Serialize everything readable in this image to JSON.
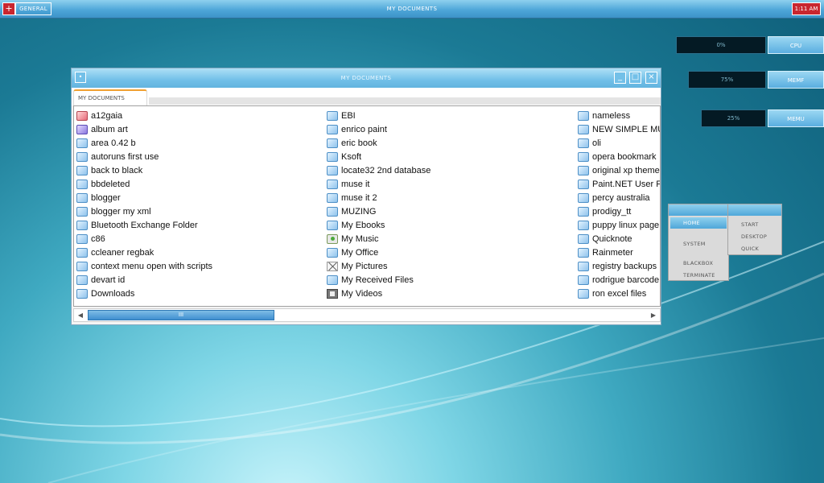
{
  "topbar": {
    "menu_button": "+",
    "general_label": "GENERAL",
    "title": "MY DOCUMENTS",
    "clock": "1:11 AM"
  },
  "meters": [
    {
      "value": "0%",
      "label": "CPU"
    },
    {
      "value": "75%",
      "label": "MEMF"
    },
    {
      "value": "25%",
      "label": "MEMU"
    }
  ],
  "window": {
    "title": "MY DOCUMENTS",
    "tab_label": "MY DOCUMENTS",
    "minimize": "_",
    "maximize": "□",
    "close": "×",
    "system_menu": "•",
    "scroll_thumb": "III",
    "scroll_left": "◀",
    "scroll_right": "▶",
    "columns": [
      [
        {
          "name": "a12gaia",
          "icon": "folder-red"
        },
        {
          "name": "album art",
          "icon": "folder-purple"
        },
        {
          "name": "area 0.42 b",
          "icon": "folder"
        },
        {
          "name": "autoruns first use",
          "icon": "folder"
        },
        {
          "name": "back to black",
          "icon": "folder"
        },
        {
          "name": "bbdeleted",
          "icon": "folder"
        },
        {
          "name": "blogger",
          "icon": "folder"
        },
        {
          "name": "blogger my xml",
          "icon": "folder"
        },
        {
          "name": "Bluetooth Exchange Folder",
          "icon": "folder"
        },
        {
          "name": "c86",
          "icon": "folder"
        },
        {
          "name": "ccleaner regbak",
          "icon": "folder"
        },
        {
          "name": "context menu open with scripts",
          "icon": "folder"
        },
        {
          "name": "devart id",
          "icon": "folder"
        },
        {
          "name": "Downloads",
          "icon": "folder"
        }
      ],
      [
        {
          "name": "EBI",
          "icon": "folder"
        },
        {
          "name": "enrico paint",
          "icon": "folder"
        },
        {
          "name": "eric book",
          "icon": "folder"
        },
        {
          "name": "Ksoft",
          "icon": "folder"
        },
        {
          "name": "locate32 2nd database",
          "icon": "folder"
        },
        {
          "name": "muse it",
          "icon": "folder"
        },
        {
          "name": "muse it 2",
          "icon": "folder"
        },
        {
          "name": "MUZING",
          "icon": "folder"
        },
        {
          "name": "My Ebooks",
          "icon": "folder"
        },
        {
          "name": "My Music",
          "icon": "music"
        },
        {
          "name": "My Office",
          "icon": "folder"
        },
        {
          "name": "My Pictures",
          "icon": "pictures"
        },
        {
          "name": "My Received Files",
          "icon": "folder"
        },
        {
          "name": "My Videos",
          "icon": "videos"
        }
      ],
      [
        {
          "name": "nameless",
          "icon": "folder"
        },
        {
          "name": "NEW SIMPLE MUSE",
          "icon": "folder"
        },
        {
          "name": "oli",
          "icon": "folder"
        },
        {
          "name": "opera bookmark",
          "icon": "folder"
        },
        {
          "name": "original xp theme c",
          "icon": "folder"
        },
        {
          "name": "Paint.NET User File",
          "icon": "folder"
        },
        {
          "name": "percy australia",
          "icon": "folder"
        },
        {
          "name": "prodigy_tt",
          "icon": "folder"
        },
        {
          "name": "puppy linux page",
          "icon": "folder"
        },
        {
          "name": "Quicknote",
          "icon": "folder"
        },
        {
          "name": "Rainmeter",
          "icon": "folder"
        },
        {
          "name": "registry backups",
          "icon": "folder"
        },
        {
          "name": "rodrigue barcode",
          "icon": "folder"
        },
        {
          "name": "ron excel files",
          "icon": "folder"
        }
      ]
    ]
  },
  "menu_main": {
    "home": "HOME",
    "system": "SYSTEM",
    "blackbox": "BLACKBOX",
    "terminate": "TERMINATE"
  },
  "menu_sub": {
    "start": "START",
    "desktop": "DESKTOP",
    "quick": "QUICK"
  }
}
